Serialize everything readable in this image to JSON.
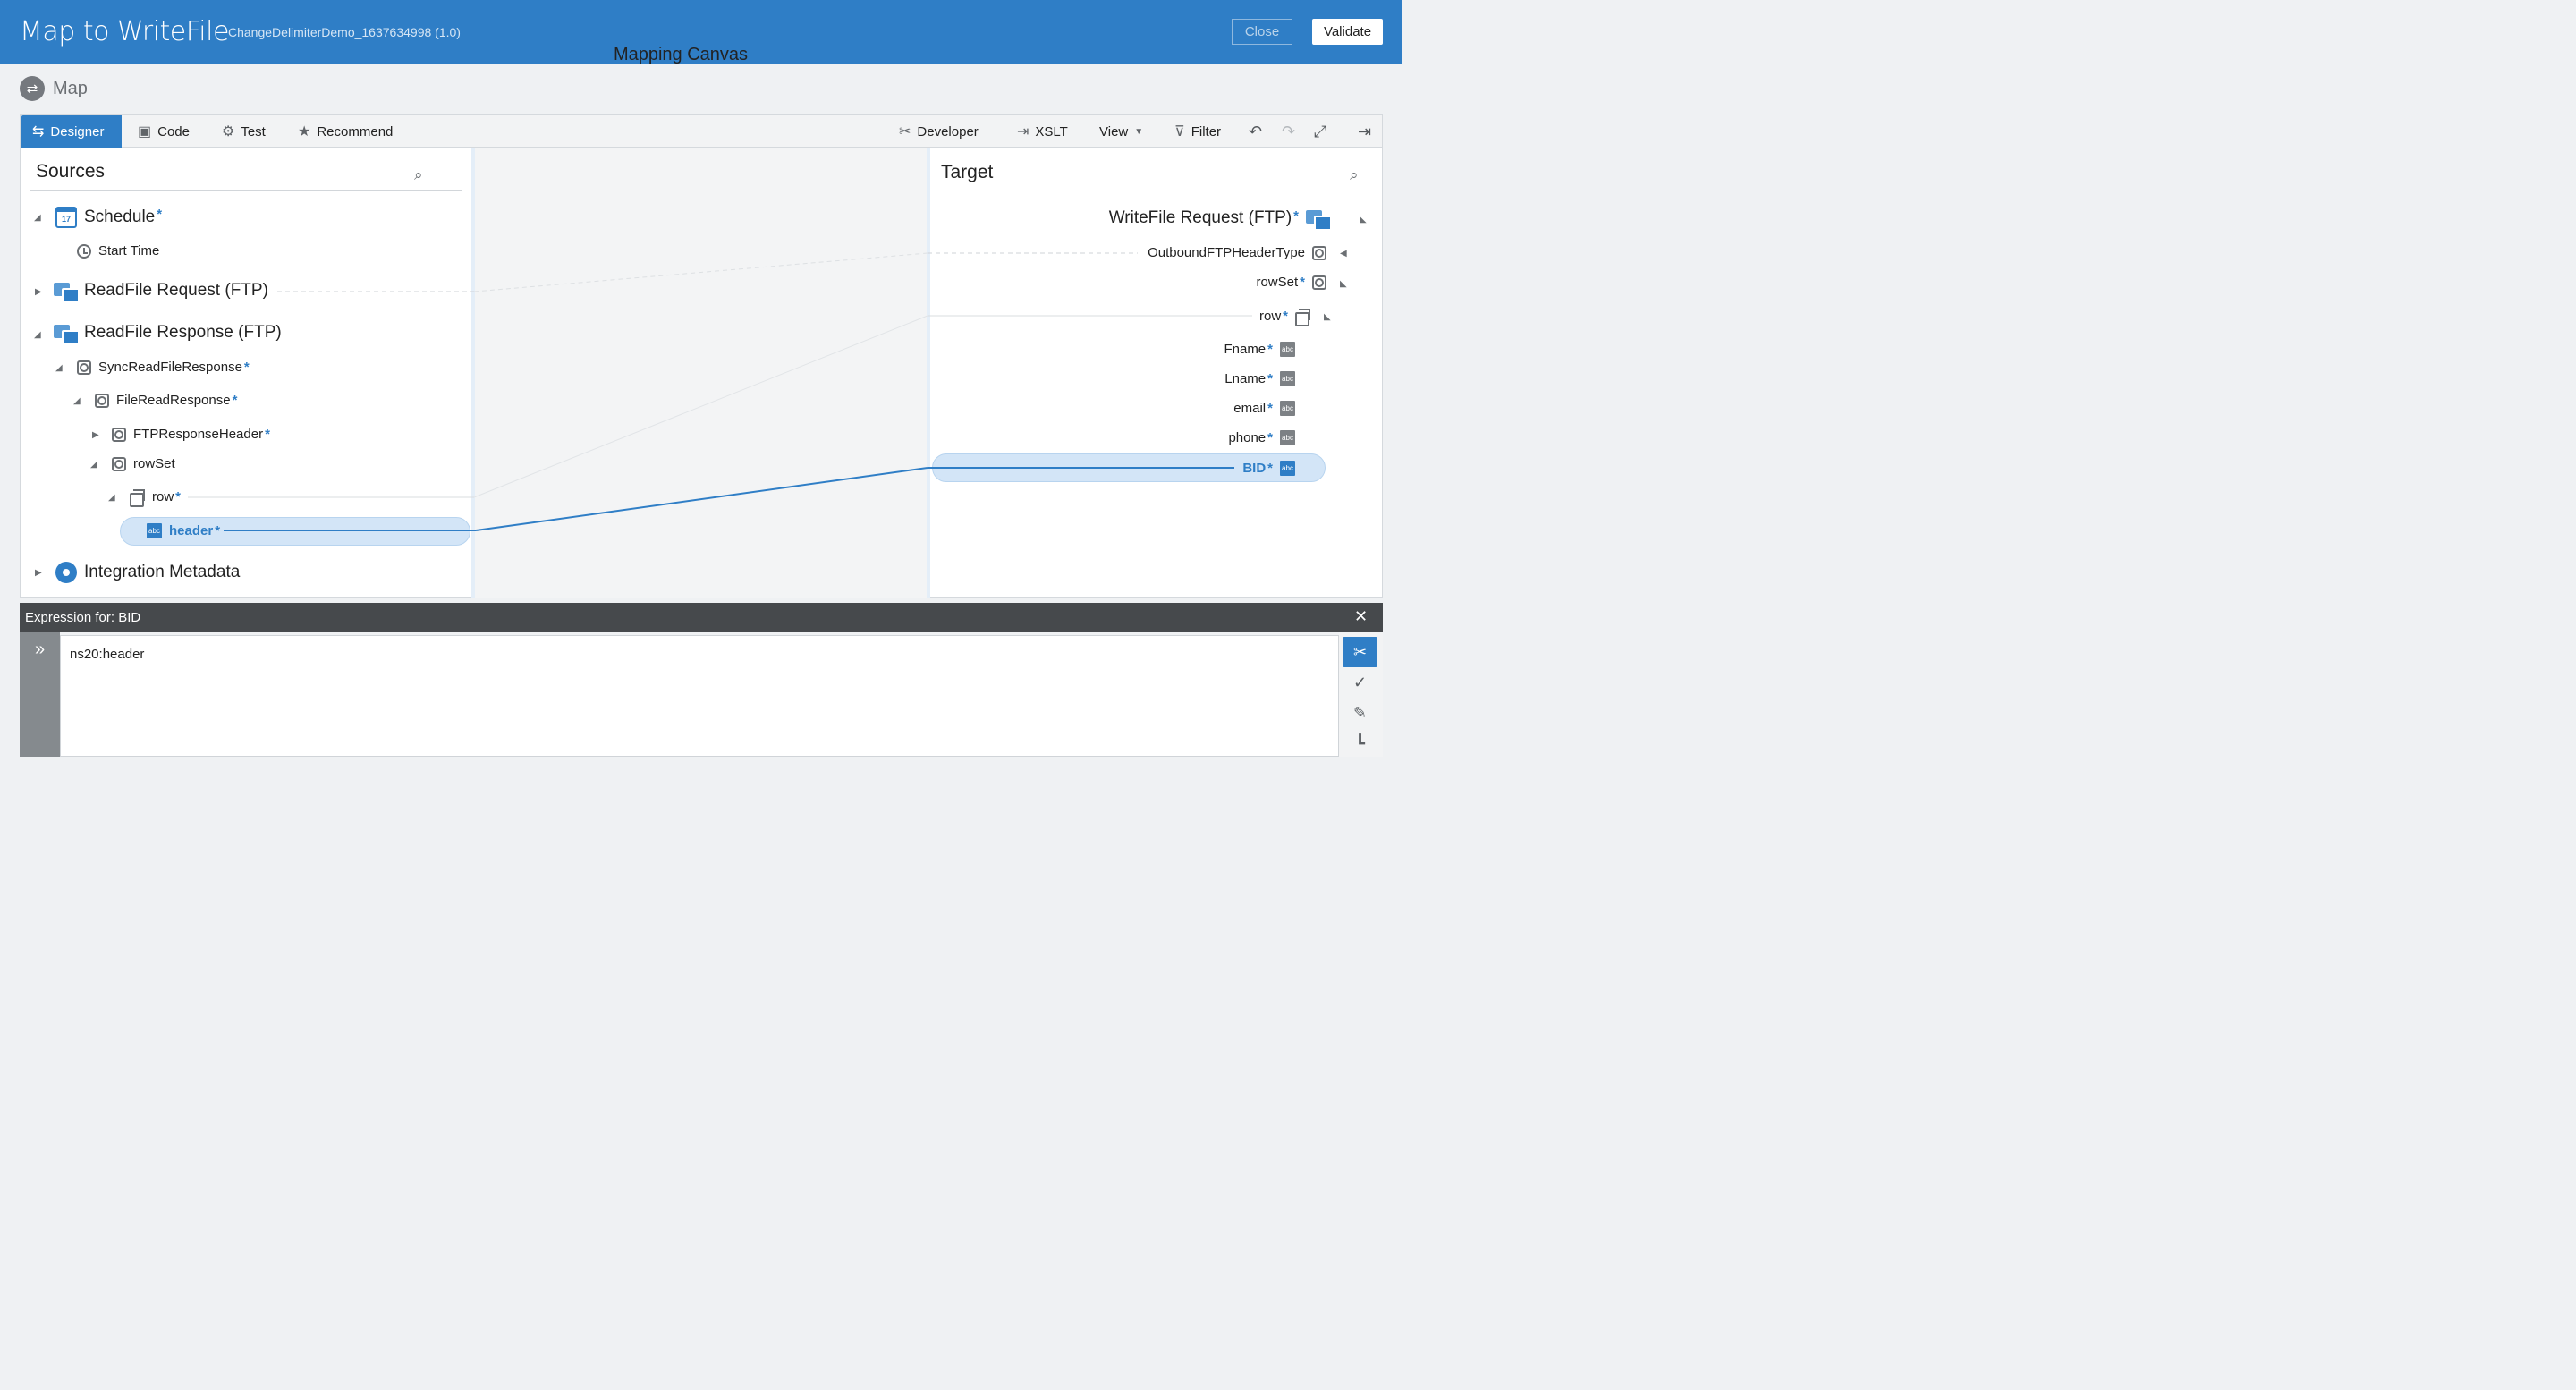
{
  "header": {
    "title": "Map to WriteFile",
    "subtitle": "ChangeDelimiterDemo_1637634998 (1.0)",
    "close_label": "Close",
    "validate_label": "Validate"
  },
  "breadcrumb": {
    "label": "Map"
  },
  "toolbar": {
    "designer": "Designer",
    "code": "Code",
    "test": "Test",
    "recommend": "Recommend",
    "developer": "Developer",
    "xslt": "XSLT",
    "view": "View",
    "filter": "Filter"
  },
  "sources": {
    "title": "Sources",
    "schedule": "Schedule",
    "start_time": "Start Time",
    "readfile_request": "ReadFile Request (FTP)",
    "readfile_response": "ReadFile Response (FTP)",
    "sync_response": "SyncReadFileResponse",
    "file_read_response": "FileReadResponse",
    "ftp_response_header": "FTPResponseHeader",
    "rowset": "rowSet",
    "row": "row",
    "header": "header",
    "integration_metadata": "Integration Metadata"
  },
  "canvas": {
    "title": "Mapping Canvas"
  },
  "target": {
    "title": "Target",
    "writefile_request": "WriteFile Request (FTP)",
    "outbound_header": "OutboundFTPHeaderType",
    "rowset": "rowSet",
    "row": "row",
    "fname": "Fname",
    "lname": "Lname",
    "email": "email",
    "phone": "phone",
    "bid": "BID"
  },
  "required_marker": "*",
  "icon_text": {
    "abc": "abc",
    "calendar_day": "17"
  },
  "expression": {
    "label": "Expression for: BID",
    "code": "ns20:header"
  },
  "colors": {
    "brand_blue": "#2f7ec6",
    "selection_fill": "#d3e5f7",
    "expression_bar": "#46494c"
  }
}
